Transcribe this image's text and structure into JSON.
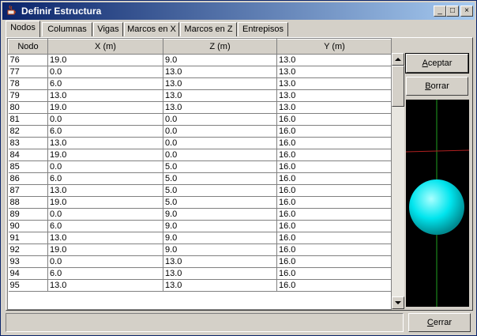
{
  "window": {
    "title": "Definir Estructura"
  },
  "titlebar_buttons": {
    "minimize": "_",
    "maximize": "□",
    "close": "×"
  },
  "tabs": [
    {
      "label": "Nodos",
      "active": true
    },
    {
      "label": "Columnas",
      "active": false
    },
    {
      "label": "Vigas",
      "active": false
    },
    {
      "label": "Marcos en X",
      "active": false
    },
    {
      "label": "Marcos en Z",
      "active": false
    },
    {
      "label": "Entrepisos",
      "active": false
    }
  ],
  "table": {
    "columns": [
      "Nodo",
      "X (m)",
      "Z (m)",
      "Y (m)"
    ],
    "rows": [
      [
        "76",
        "19.0",
        "9.0",
        "13.0"
      ],
      [
        "77",
        "0.0",
        "13.0",
        "13.0"
      ],
      [
        "78",
        "6.0",
        "13.0",
        "13.0"
      ],
      [
        "79",
        "13.0",
        "13.0",
        "13.0"
      ],
      [
        "80",
        "19.0",
        "13.0",
        "13.0"
      ],
      [
        "81",
        "0.0",
        "0.0",
        "16.0"
      ],
      [
        "82",
        "6.0",
        "0.0",
        "16.0"
      ],
      [
        "83",
        "13.0",
        "0.0",
        "16.0"
      ],
      [
        "84",
        "19.0",
        "0.0",
        "16.0"
      ],
      [
        "85",
        "0.0",
        "5.0",
        "16.0"
      ],
      [
        "86",
        "6.0",
        "5.0",
        "16.0"
      ],
      [
        "87",
        "13.0",
        "5.0",
        "16.0"
      ],
      [
        "88",
        "19.0",
        "5.0",
        "16.0"
      ],
      [
        "89",
        "0.0",
        "9.0",
        "16.0"
      ],
      [
        "90",
        "6.0",
        "9.0",
        "16.0"
      ],
      [
        "91",
        "13.0",
        "9.0",
        "16.0"
      ],
      [
        "92",
        "19.0",
        "9.0",
        "16.0"
      ],
      [
        "93",
        "0.0",
        "13.0",
        "16.0"
      ],
      [
        "94",
        "6.0",
        "13.0",
        "16.0"
      ],
      [
        "95",
        "13.0",
        "13.0",
        "16.0"
      ]
    ]
  },
  "buttons": {
    "aceptar": {
      "label": "Aceptar",
      "mnemonic": "A",
      "rest": "ceptar"
    },
    "borrar": {
      "label": "Borrar",
      "mnemonic": "B",
      "rest": "orrar"
    },
    "cerrar": {
      "label": "Cerrar",
      "mnemonic": "C",
      "rest": "errar"
    }
  },
  "viewer": {
    "background": "#000000",
    "sphere_color": "#00e5ee",
    "axis_y_color": "#1fa01f",
    "axis_x_color": "#b02020"
  },
  "icons": {
    "app": "java-cup-icon",
    "scroll_up": "arrow-up-icon",
    "scroll_down": "arrow-down-icon"
  }
}
